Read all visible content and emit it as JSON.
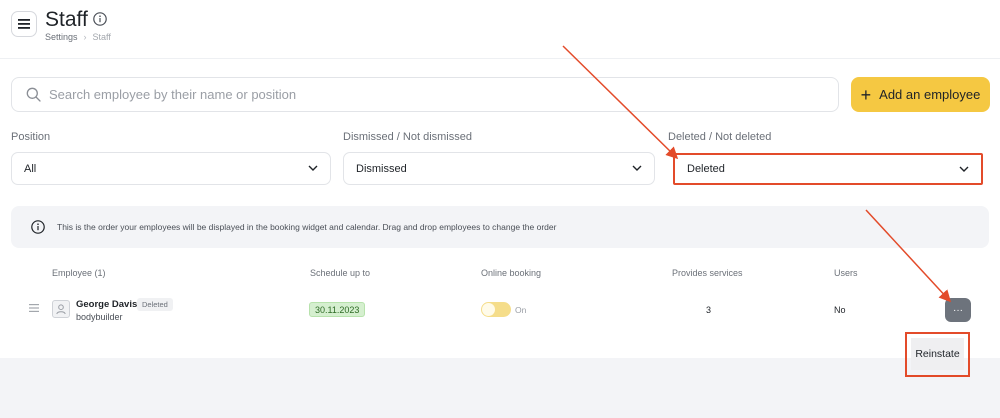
{
  "header": {
    "title": "Staff",
    "breadcrumb": {
      "root": "Settings",
      "separator": "›",
      "current": "Staff"
    }
  },
  "search": {
    "placeholder": "Search employee by their name or position",
    "value": ""
  },
  "toolbar": {
    "add_label": "Add an employee",
    "add_symbol": "+"
  },
  "filters": {
    "position": {
      "label": "Position",
      "value": "All"
    },
    "dismissed": {
      "label": "Dismissed / Not dismissed",
      "value": "Dismissed"
    },
    "deleted": {
      "label": "Deleted / Not deleted",
      "value": "Deleted"
    }
  },
  "notice": {
    "text": "This is the order your employees will be displayed in the booking widget and calendar. Drag and drop employees to change the order"
  },
  "table": {
    "columns": {
      "employee": "Employee (1)",
      "schedule": "Schedule up to",
      "online": "Online booking",
      "services": "Provides services",
      "users": "Users"
    },
    "rows": [
      {
        "name": "George Davis",
        "badge": "Deleted",
        "position": "bodybuilder",
        "schedule": "30.11.2023",
        "online_label": "On",
        "online_enabled": true,
        "services": "3",
        "users": "No",
        "more": "···"
      }
    ]
  },
  "context_menu": {
    "reinstate_label": "Reinstate"
  },
  "colors": {
    "accent": "#f5c842",
    "annotation": "#e34b2a",
    "badge_green_bg": "#d5efcf",
    "more_button": "#6d737c"
  },
  "icons": [
    "menu-icon",
    "info-icon",
    "search-icon",
    "plus-icon",
    "chevron-down-icon",
    "drag-handle-icon",
    "avatar-icon"
  ]
}
